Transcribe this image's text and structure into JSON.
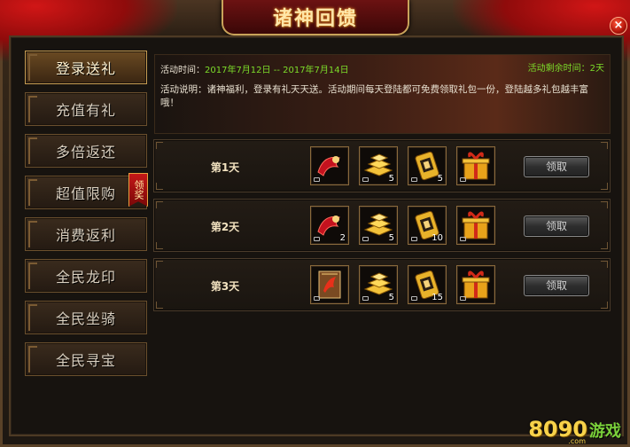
{
  "window": {
    "title": "诸神回馈"
  },
  "sidebar": {
    "items": [
      {
        "label": "登录送礼",
        "active": true
      },
      {
        "label": "充值有礼"
      },
      {
        "label": "多倍返还"
      },
      {
        "label": "超值限购",
        "ribbon": "领奖"
      },
      {
        "label": "消费返利"
      },
      {
        "label": "全民龙印"
      },
      {
        "label": "全民坐骑"
      },
      {
        "label": "全民寻宝"
      }
    ]
  },
  "activity": {
    "time_label": "活动时间：",
    "time_range": "2017年7月12日 -- 2017年7月14日",
    "remaining_label": "活动剩余时间：",
    "remaining_value": "2天",
    "desc": "活动说明：诸神福利，登录有礼天天送。活动期间每天登陆都可免费领取礼包一份，登陆越多礼包越丰富哦！"
  },
  "rewards": [
    {
      "day": "第1天",
      "items": [
        {
          "icon": "red-jewel-icon",
          "count": ""
        },
        {
          "icon": "gold-bars-icon",
          "count": "5"
        },
        {
          "icon": "gold-scroll-icon",
          "count": "5"
        },
        {
          "icon": "gift-box-icon",
          "count": ""
        }
      ],
      "button": "领取"
    },
    {
      "day": "第2天",
      "items": [
        {
          "icon": "red-jewel-icon",
          "count": "2"
        },
        {
          "icon": "gold-bars-icon",
          "count": "5"
        },
        {
          "icon": "gold-scroll-icon",
          "count": "10"
        },
        {
          "icon": "gift-box-icon",
          "count": ""
        }
      ],
      "button": "领取"
    },
    {
      "day": "第3天",
      "items": [
        {
          "icon": "spell-book-icon",
          "count": ""
        },
        {
          "icon": "gold-bars-icon",
          "count": "5"
        },
        {
          "icon": "gold-scroll-icon",
          "count": "15"
        },
        {
          "icon": "gift-box-icon",
          "count": ""
        }
      ],
      "button": "领取"
    }
  ],
  "close": {
    "label": "×"
  },
  "watermark": {
    "num": "8090",
    "game": "游戏",
    "site": ".com"
  },
  "colors": {
    "accent_green": "#7cdc2a",
    "title_red": "#6c1212",
    "gold": "#c9a35a"
  }
}
